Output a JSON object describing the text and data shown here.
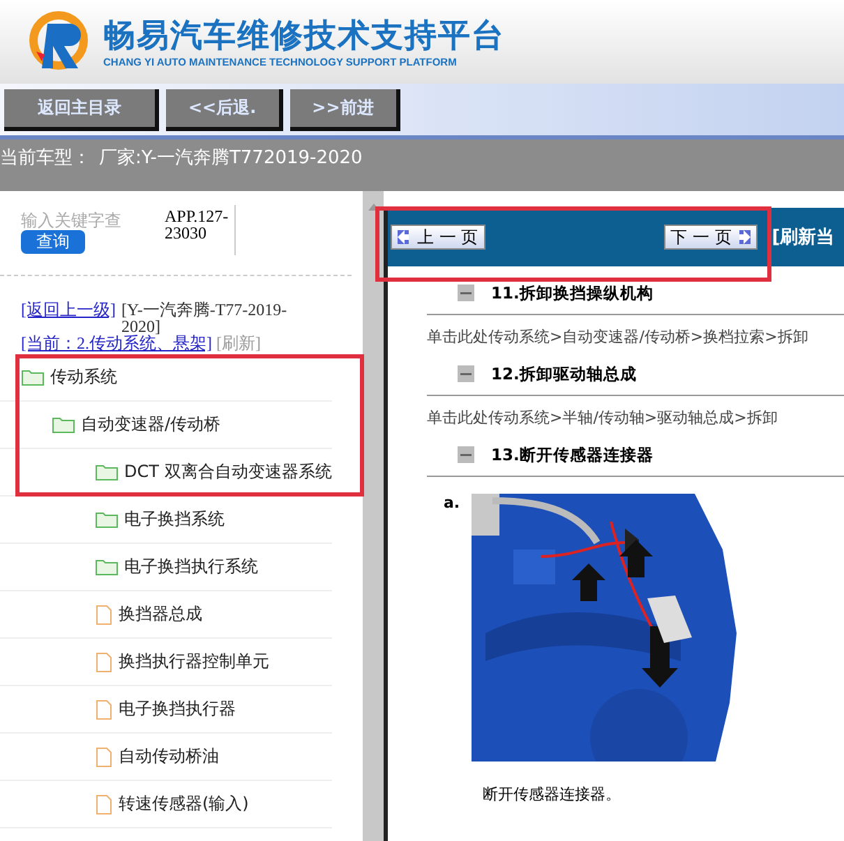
{
  "header": {
    "title": "畅易汽车维修技术支持平台",
    "subtitle": "CHANG YI AUTO MAINTENANCE TECHNOLOGY SUPPORT PLATFORM"
  },
  "nav_buttons": [
    "返回主目录",
    "<<后退.",
    ">>前进"
  ],
  "vehicle_bar": {
    "label": "当前车型：",
    "value": "厂家:Y-一汽奔腾T772019-2020"
  },
  "search": {
    "placeholder": "输入关键字查",
    "button": "查询",
    "code": "APP.127-23030"
  },
  "breadcrumb": {
    "back_link": "[返回上一级]",
    "vehicle": "[Y-一汽奔腾-T77-2019-2020]",
    "current": "[当前：2.传动系统、悬架]",
    "refresh": "[刷新]"
  },
  "tree": [
    {
      "label": "传动系统",
      "kind": "folder",
      "children": [
        {
          "label": "自动变速器/传动桥",
          "kind": "folder",
          "children": [
            {
              "label": "DCT 双离合自动变速器系统",
              "kind": "folder"
            },
            {
              "label": "电子换挡系统",
              "kind": "folder"
            },
            {
              "label": "电子换挡执行系统",
              "kind": "folder"
            },
            {
              "label": "换挡器总成",
              "kind": "file"
            },
            {
              "label": "换挡执行器控制单元",
              "kind": "file"
            },
            {
              "label": "电子换挡执行器",
              "kind": "file"
            },
            {
              "label": "自动传动桥油",
              "kind": "file"
            },
            {
              "label": "转速传感器(输入)",
              "kind": "file"
            }
          ]
        }
      ]
    }
  ],
  "doc_toolbar": {
    "prev": "上 一 页",
    "next": "下 一 页",
    "refresh": "[刷新当"
  },
  "steps": [
    {
      "title": "11.拆卸换挡操纵机构",
      "link": "单击此处传动系统>自动变速器/传动桥>换档拉索>拆卸"
    },
    {
      "title": "12.拆卸驱动轴总成",
      "link": "单击此处传动系统>半轴/传动轴>驱动轴总成>拆卸"
    },
    {
      "title": "13.断开传感器连接器",
      "substep": "a.",
      "caption": "断开传感器连接器。"
    }
  ]
}
